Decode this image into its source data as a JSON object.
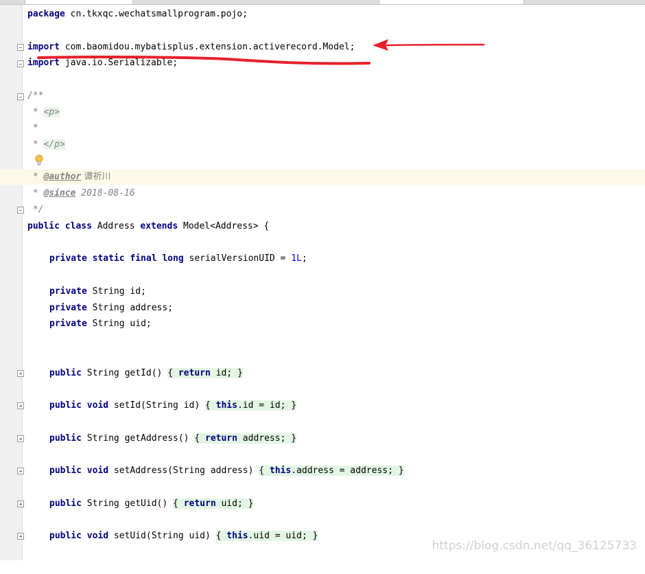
{
  "editor": {
    "lines": {
      "package": {
        "kw": "package",
        "rest": " cn.tkxqc.wechatsmallprogram.pojo;"
      },
      "import1": {
        "kw": "import",
        "rest": " com.baomidou.mybatisplus.extension.activerecord.Model;"
      },
      "import2": {
        "kw": "import",
        "rest": " java.io.Serializable;"
      },
      "doc_open": "/**",
      "doc_p_star": " * ",
      "doc_p_open": "<p>",
      "doc_empty": " *",
      "doc_p_close_star": " * ",
      "doc_p_close": "</p>",
      "author": {
        "star": " * ",
        "tag": "@author",
        "value": " 谭祈川"
      },
      "since": {
        "star": " * ",
        "tag": "@since",
        "value": " 2018-08-16"
      },
      "doc_close": " */",
      "class_decl": {
        "kw1": "public class",
        "name": " Address ",
        "kw2": "extends",
        "rest": " Model<Address> {"
      },
      "serial": {
        "kw": "private static final long",
        "name": " serialVersionUID = ",
        "num": "1L",
        "end": ";"
      },
      "field_id": {
        "kw": "private",
        "rest": " String id;"
      },
      "field_address": {
        "kw": "private",
        "rest": " String address;"
      },
      "field_uid": {
        "kw": "private",
        "rest": " String uid;"
      },
      "getId": {
        "kw": "public",
        "sig": " String getId() ",
        "ob": "{ ",
        "kw2": "return",
        "body": " id;",
        "cb": " }"
      },
      "setId": {
        "kw": "public void",
        "sig": " setId(String id) ",
        "ob": "{ ",
        "kw2": "this",
        "body": ".id = id;",
        "cb": " }"
      },
      "getAddress": {
        "kw": "public",
        "sig": " String getAddress() ",
        "ob": "{ ",
        "kw2": "return",
        "body": " address;",
        "cb": " }"
      },
      "setAddress": {
        "kw": "public void",
        "sig": " setAddress(String address) ",
        "ob": "{ ",
        "kw2": "this",
        "body": ".address = address;",
        "cb": " }"
      },
      "getUid": {
        "kw": "public",
        "sig": " String getUid() ",
        "ob": "{ ",
        "kw2": "return",
        "body": " uid;",
        "cb": " }"
      },
      "setUid": {
        "kw": "public void",
        "sig": " setUid(String uid) ",
        "ob": "{ ",
        "kw2": "this",
        "body": ".uid = uid;",
        "cb": " }"
      }
    }
  },
  "watermark": "https://blog.csdn.net/qq_36125733",
  "colors": {
    "keyword": "#000080",
    "number": "#0000ff",
    "comment": "#808080",
    "annotation_red": "#e8202a",
    "current_line": "#fcfae6",
    "brace_highlight": "#e3f5e3"
  }
}
